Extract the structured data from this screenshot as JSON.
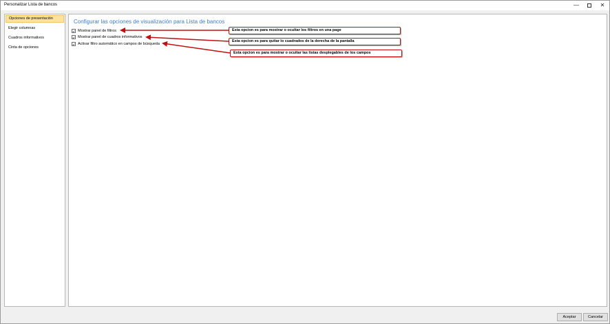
{
  "window": {
    "title": "Personalizar Lista de bancos",
    "minimize_glyph": "—",
    "close_glyph": "✕"
  },
  "sidebar": {
    "items": [
      {
        "label": "Opciones de presentación",
        "selected": true
      },
      {
        "label": "Elegir columnas",
        "selected": false
      },
      {
        "label": "Cuadros informativos",
        "selected": false
      },
      {
        "label": "Cinta de opciones",
        "selected": false
      }
    ]
  },
  "main": {
    "heading": "Configurar las opciones de visualización para Lista de bancos",
    "options": [
      {
        "label": "Mostrar panel de filtros",
        "checked": true
      },
      {
        "label": "Mostrar panel de cuadros informativos",
        "checked": true
      },
      {
        "label": "Activar filtro automático en campos de búsqueda",
        "checked": true
      }
    ]
  },
  "annotations": [
    {
      "text": "Esta opcion es para mostrar o ocultar los filtros en una page"
    },
    {
      "text": "Esta opcion es para quitar lo cuadrados de la derecha de la pantalla"
    },
    {
      "text": "Esta opcion es para mostrar o ocultar las listas desplegables de los campos"
    }
  ],
  "annotation_color": "#c10f0f",
  "accent_color": "#3d7bd6",
  "selection_color": "#fce29d",
  "footer": {
    "ok_label": "Aceptar",
    "cancel_label": "Cancelar"
  }
}
